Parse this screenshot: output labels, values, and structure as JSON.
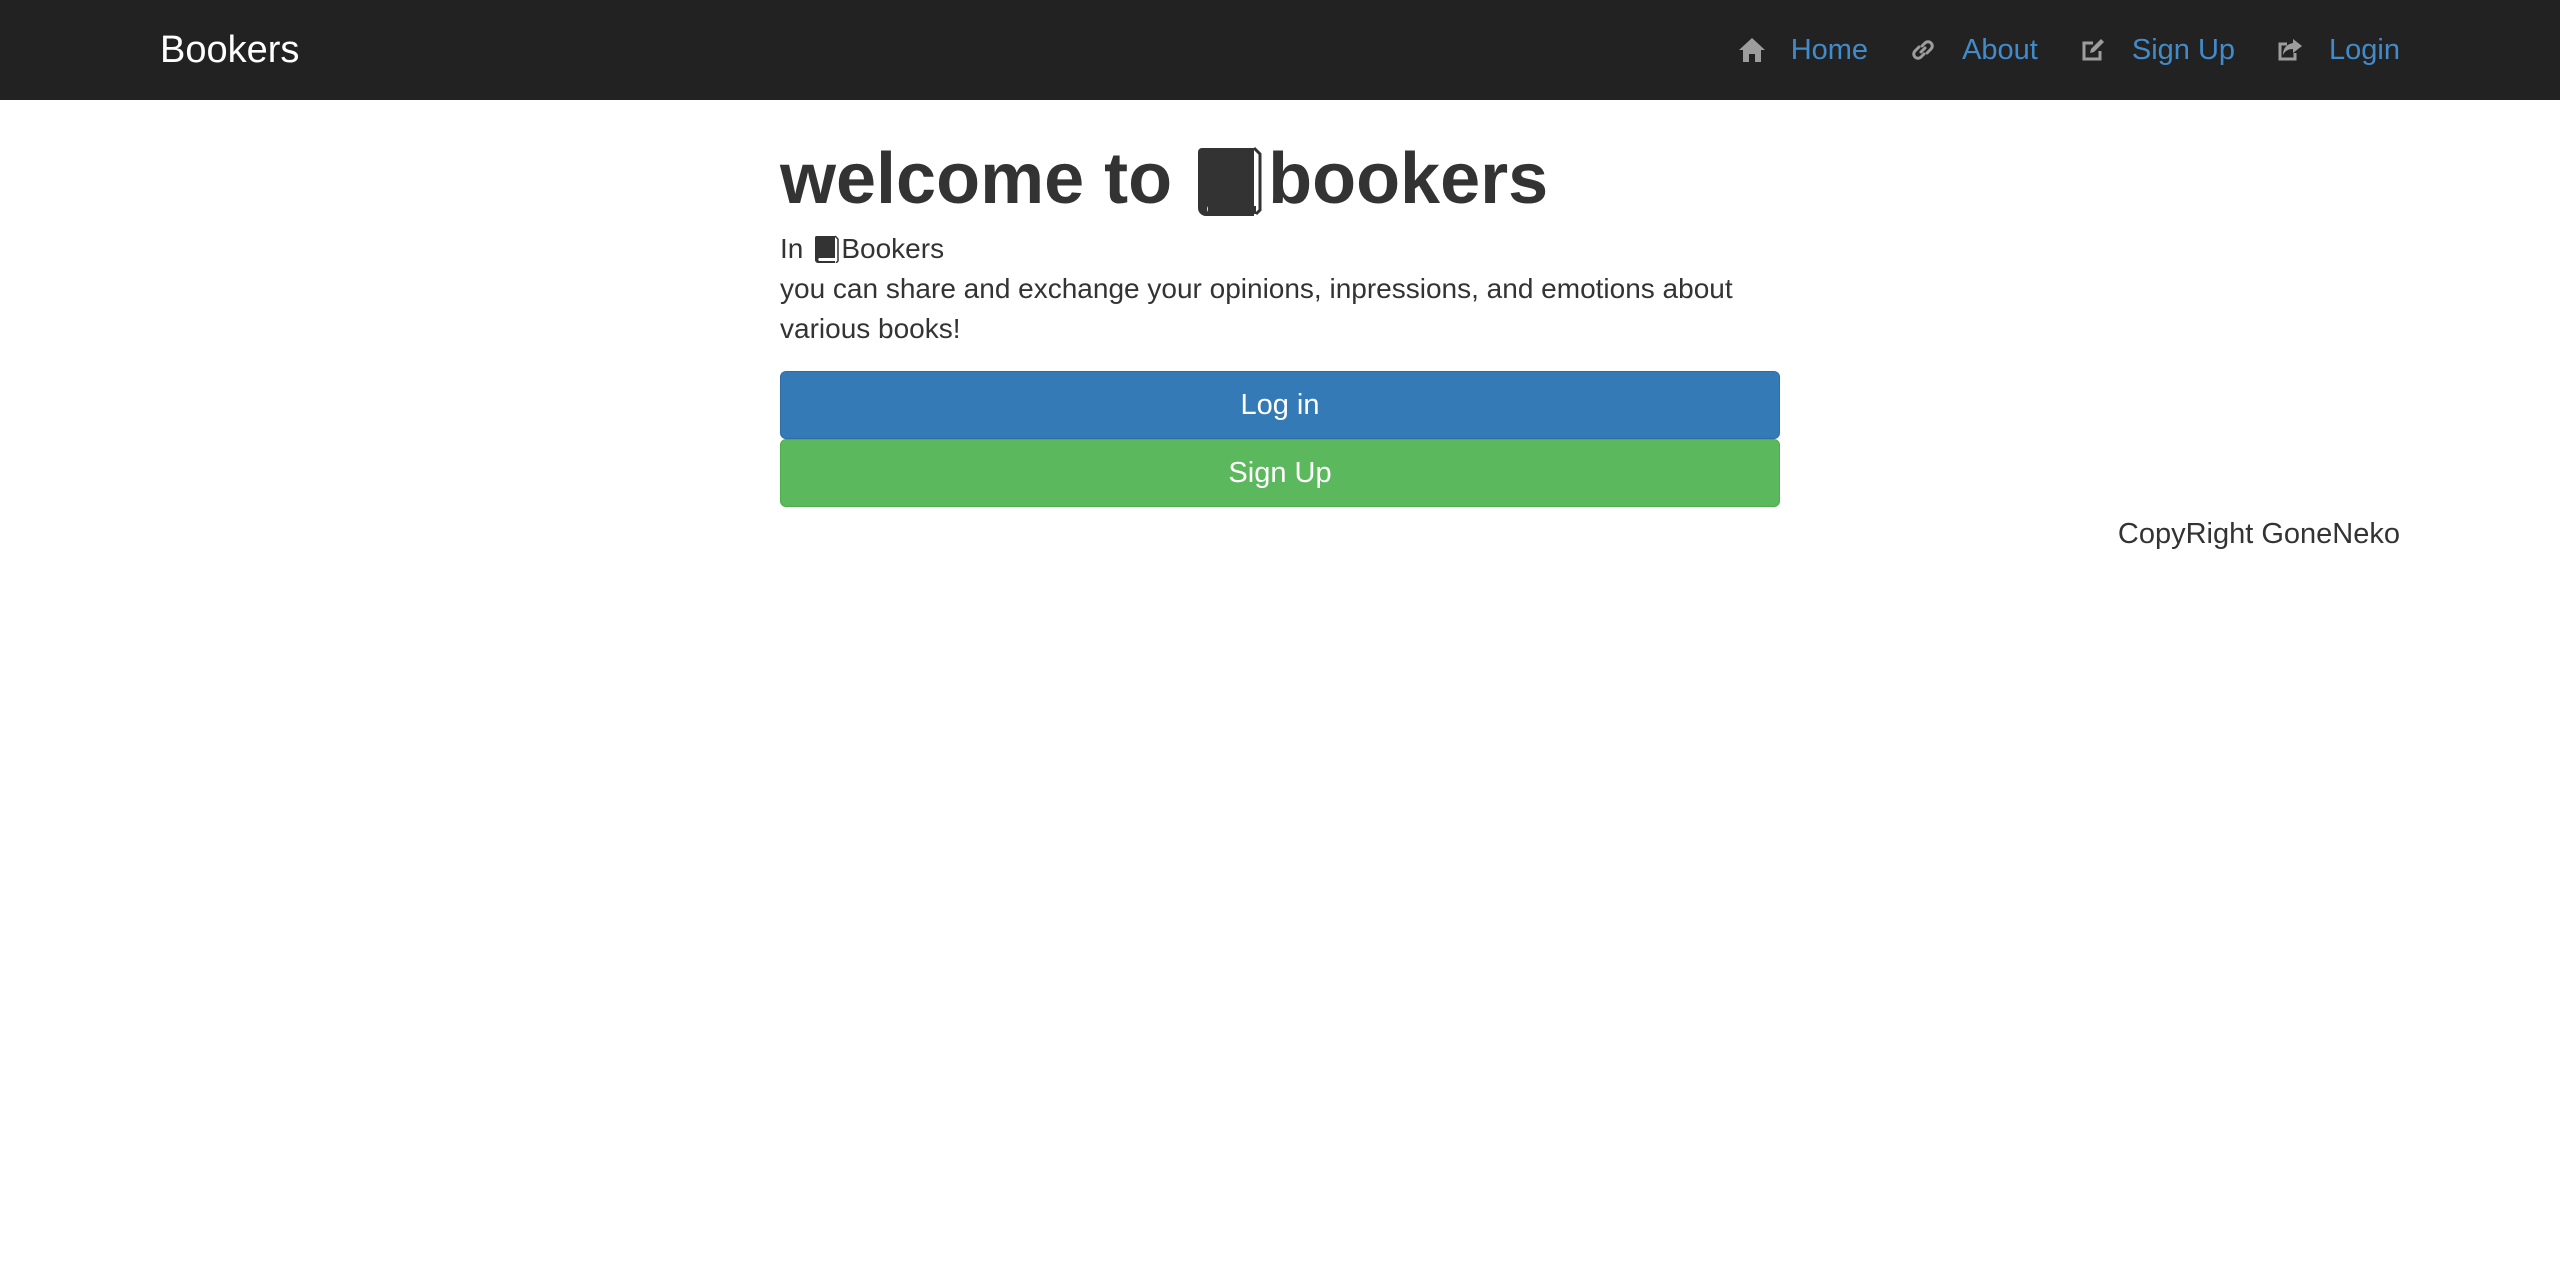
{
  "navbar": {
    "brand": "Bookers",
    "items": [
      {
        "label": "Home",
        "icon": "home-icon"
      },
      {
        "label": "About",
        "icon": "link-icon"
      },
      {
        "label": "Sign Up",
        "icon": "edit-icon"
      },
      {
        "label": "Login",
        "icon": "share-icon"
      }
    ]
  },
  "main": {
    "title_prefix": "welcome to",
    "title_suffix": "bookers",
    "intro_prefix": "In",
    "intro_brand": "Bookers",
    "intro_text": "you can share and exchange your opinions, inpressions, and emotions about various books!",
    "login_button": "Log in",
    "signup_button": "Sign Up"
  },
  "footer": {
    "copyright": "CopyRight GoneNeko"
  },
  "colors": {
    "navbar_bg": "#222222",
    "link": "#428bca",
    "primary": "#337ab7",
    "success": "#5cb85c"
  }
}
